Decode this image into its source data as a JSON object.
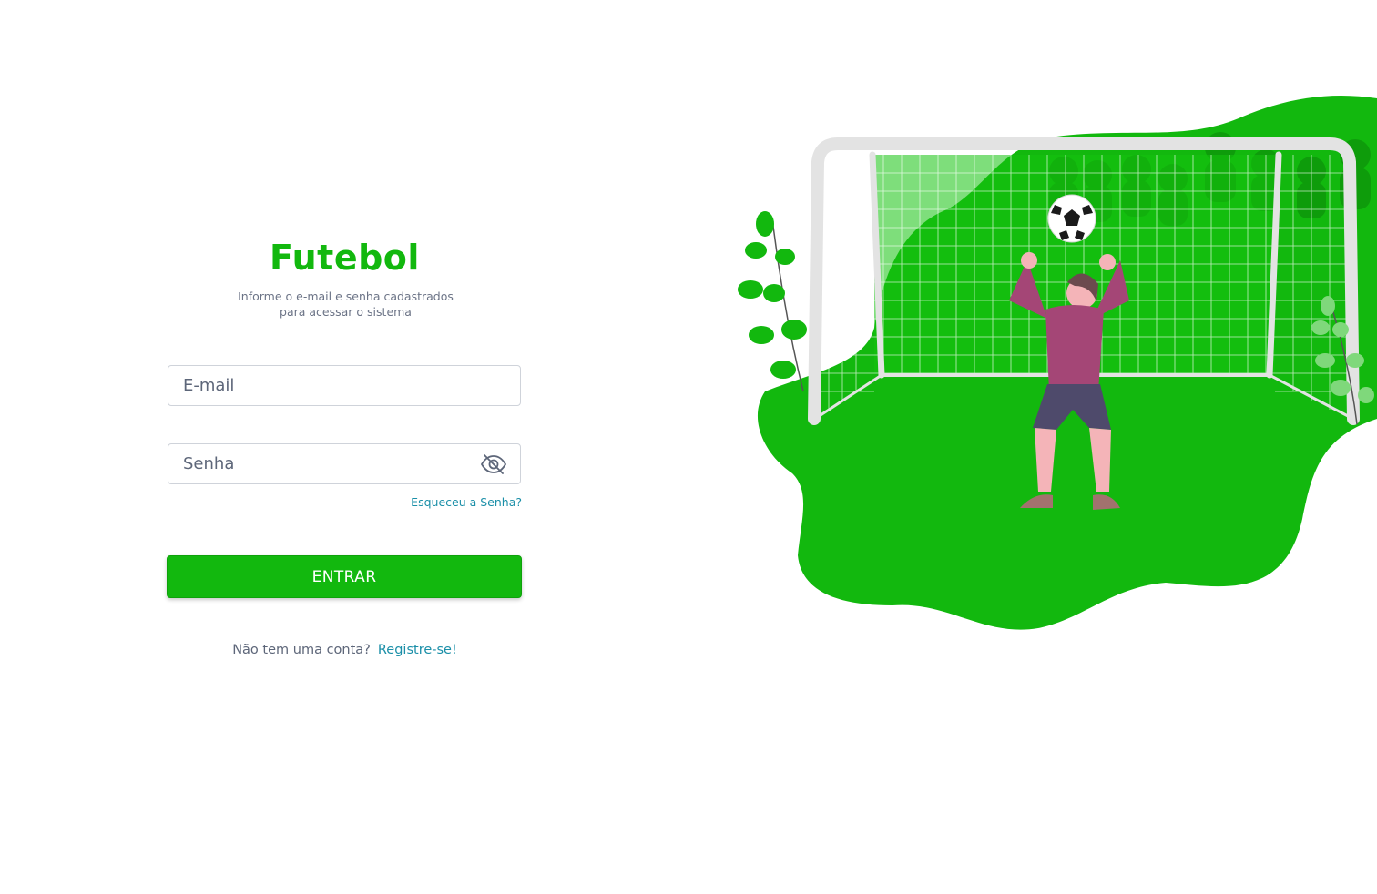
{
  "brand": {
    "title": "Futebol",
    "subtitle_line1": "Informe o e-mail e senha cadastrados",
    "subtitle_line2": "para acessar o sistema"
  },
  "form": {
    "email_placeholder": "E-mail",
    "password_placeholder": "Senha",
    "forgot_label": "Esqueceu a Senha?",
    "submit_label": "ENTRAR"
  },
  "register": {
    "prompt": "Não tem uma conta?",
    "link_label": "Registre-se!"
  },
  "icons": {
    "password_toggle": "eye-off-icon"
  },
  "colors": {
    "accent": "#12b80e",
    "link": "#1b8fa8",
    "text_muted": "#6b7386"
  }
}
